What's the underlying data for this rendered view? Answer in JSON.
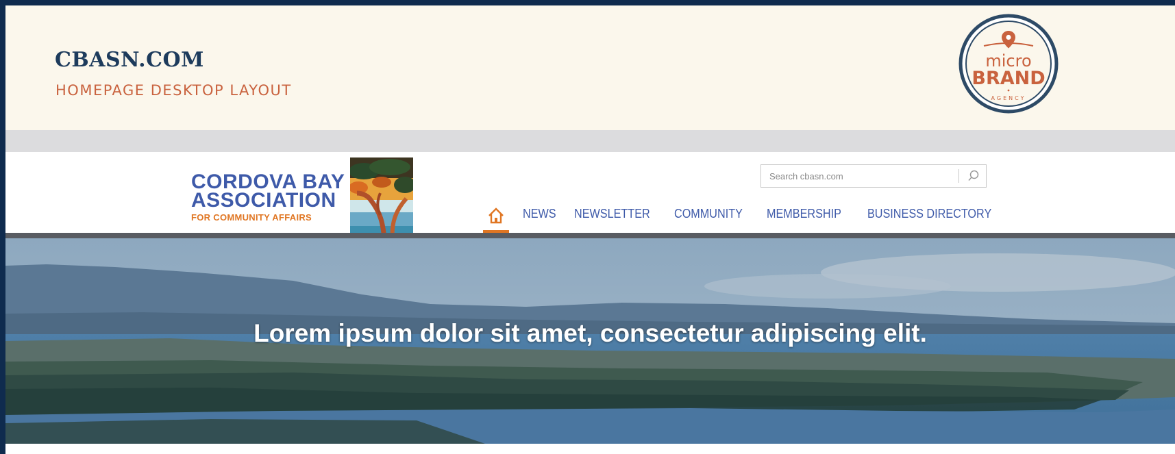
{
  "presentation": {
    "title": "CBASN.COM",
    "subtitle": "HOMEPAGE DESKTOP LAYOUT",
    "agency_logo": {
      "line1": "micro",
      "line2": "BRAND",
      "line3": "AGENCY",
      "icon": "map-pin-icon"
    }
  },
  "site": {
    "logo": {
      "line1": "CORDOVA BAY",
      "line2": "ASSOCIATION",
      "line3": "FOR COMMUNITY AFFAIRS",
      "art": "arbutus-tree-painting"
    },
    "search": {
      "placeholder": "Search cbasn.com",
      "icon": "search-icon"
    },
    "nav": {
      "home_icon": "home-icon",
      "items": [
        "NEWS",
        "NEWSLETTER",
        "COMMUNITY",
        "MEMBERSHIP",
        "BUSINESS DIRECTORY"
      ],
      "active": "home"
    },
    "hero": {
      "headline": "Lorem ipsum dolor sit amet, consectetur adipiscing elit."
    }
  },
  "colors": {
    "outer_border": "#0f2b4e",
    "pres_background": "#fbf7ec",
    "pres_title": "#1d3b5c",
    "pres_subtitle": "#c9623e",
    "brand_blue": "#3e5aa9",
    "brand_orange": "#e07623",
    "divider_gray": "#595c62"
  }
}
